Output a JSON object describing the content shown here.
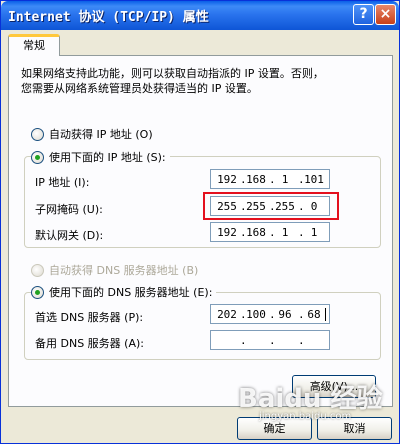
{
  "window": {
    "title": "Internet 协议 (TCP/IP) 属性",
    "help_glyph": "?",
    "close_glyph": "×"
  },
  "tabs": [
    {
      "label": "常规"
    }
  ],
  "description": "如果网络支持此功能，则可以获取自动指派的 IP 设置。否则，\n您需要从网络系统管理员处获得适当的 IP 设置。",
  "ip_section": {
    "auto_label": "自动获得 IP 地址 (O)",
    "manual_label": "使用下面的 IP 地址 (S):",
    "selected": "manual",
    "fields": [
      {
        "label": "IP 地址 (I):",
        "segments": [
          "192",
          "168",
          "1",
          "101"
        ]
      },
      {
        "label": "子网掩码 (U):",
        "segments": [
          "255",
          "255",
          "255",
          "0"
        ]
      },
      {
        "label": "默认网关 (D):",
        "segments": [
          "192",
          "168",
          "1",
          "1"
        ]
      }
    ]
  },
  "dns_section": {
    "auto_label": "自动获得 DNS 服务器地址 (B)",
    "manual_label": "使用下面的 DNS 服务器地址 (E):",
    "selected": "manual",
    "fields": [
      {
        "label": "首选 DNS 服务器 (P):",
        "segments": [
          "202",
          "100",
          "96",
          "68"
        ]
      },
      {
        "label": "备用 DNS 服务器 (A):",
        "segments": [
          "",
          "",
          "",
          ""
        ]
      }
    ]
  },
  "buttons": {
    "advanced": "高级(V)...",
    "ok": "确定",
    "cancel": "取消"
  },
  "watermark": {
    "logo_text": "Baidu 经验",
    "url": "jingyan.baidu.com"
  },
  "colors": {
    "titlebar": "#0a5fe8",
    "highlight_box": "#e4101e",
    "dialog_bg": "#ece9d8"
  }
}
